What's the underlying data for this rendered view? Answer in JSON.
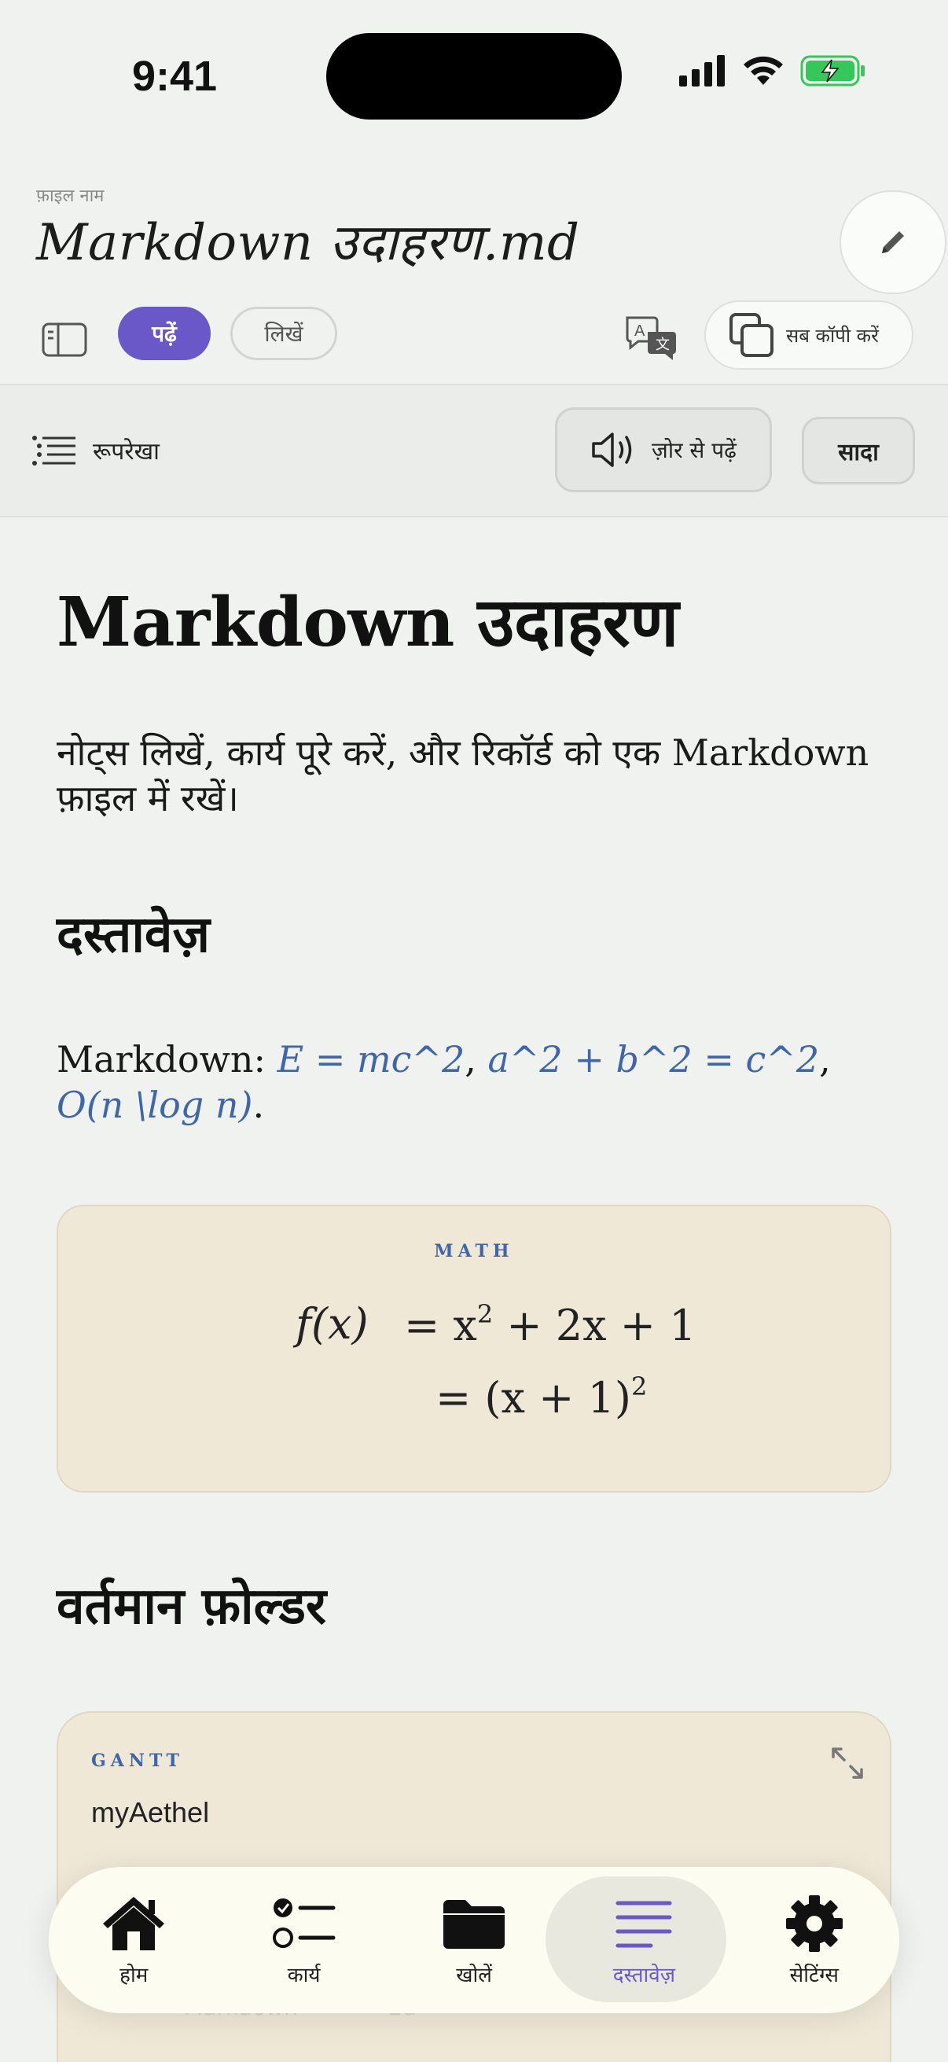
{
  "status_bar": {
    "time": "9:41"
  },
  "header": {
    "file_label": "फ़ाइल नाम",
    "file_name": "Markdown उदाहरण.md"
  },
  "toolbar": {
    "read_label": "पढ़ें",
    "write_label": "लिखें",
    "copy_all_label": "सब कॉपी करें"
  },
  "subbar": {
    "outline_label": "रूपरेखा",
    "read_aloud_label": "ज़ोर से पढ़ें",
    "plain_label": "सादा"
  },
  "document": {
    "title": "Markdown उदाहरण",
    "intro": "नोट्स लिखें, कार्य पूरे करें, और रिकॉर्ड को एक Markdown फ़ाइल में रखें।",
    "section_docs": "दस्तावेज़",
    "formula_prefix": "Markdown: ",
    "formula_1": "E = mc^2",
    "formula_2": "a^2 + b^2 = c^2",
    "formula_3": "O(n \\log n)",
    "math_block": {
      "label": "MATH",
      "line1_lhs": "f(x)",
      "line1_rhs": "= x",
      "line1_exp": "2",
      "line1_tail": " + 2x + 1",
      "line2_rhs": "= (x + 1)",
      "line2_exp": "2"
    },
    "section_folder": "वर्तमान फ़ोल्डर",
    "gantt": {
      "label": "GANTT",
      "title": "myAethel",
      "row_label": "Markdown",
      "row_value": "2d"
    }
  },
  "nav": {
    "items": [
      {
        "label": "होम",
        "icon": "home-icon"
      },
      {
        "label": "कार्य",
        "icon": "tasks-icon"
      },
      {
        "label": "खोलें",
        "icon": "folder-icon"
      },
      {
        "label": "दस्तावेज़",
        "icon": "document-lines-icon",
        "active": true
      },
      {
        "label": "सेटिंग्स",
        "icon": "gear-icon"
      }
    ],
    "active_color": "#6b58c8"
  },
  "colors": {
    "accent": "#6b58c8",
    "link": "#3f66a8",
    "card": "#efe8d7",
    "battery": "#34c759"
  }
}
